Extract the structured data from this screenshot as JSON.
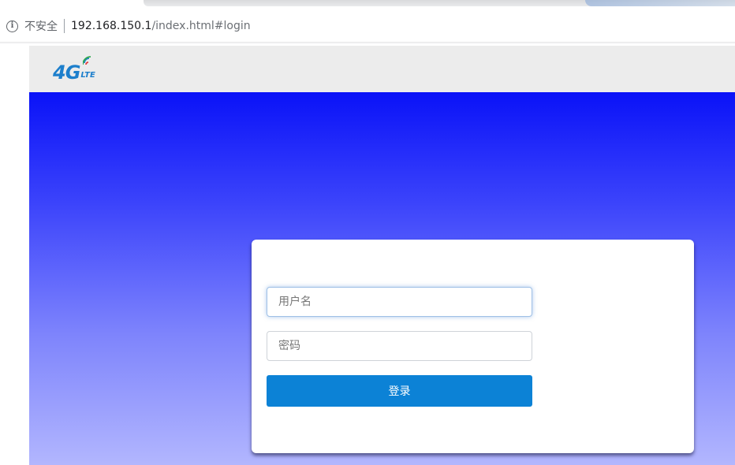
{
  "browser": {
    "security_label": "不安全",
    "url_host": "192.168.150.1",
    "url_path": "/index.html#login"
  },
  "header": {
    "logo_text_main": "4G",
    "logo_text_sub": "LTE",
    "logo_color": "#1d7fcc"
  },
  "hero": {
    "gradient_top": "#0a12f8",
    "gradient_bottom": "#b2b6fe"
  },
  "login": {
    "username_placeholder": "用户名",
    "username_value": "",
    "password_placeholder": "密码",
    "password_value": "",
    "submit_label": "登录",
    "submit_color": "#0c82d6"
  }
}
